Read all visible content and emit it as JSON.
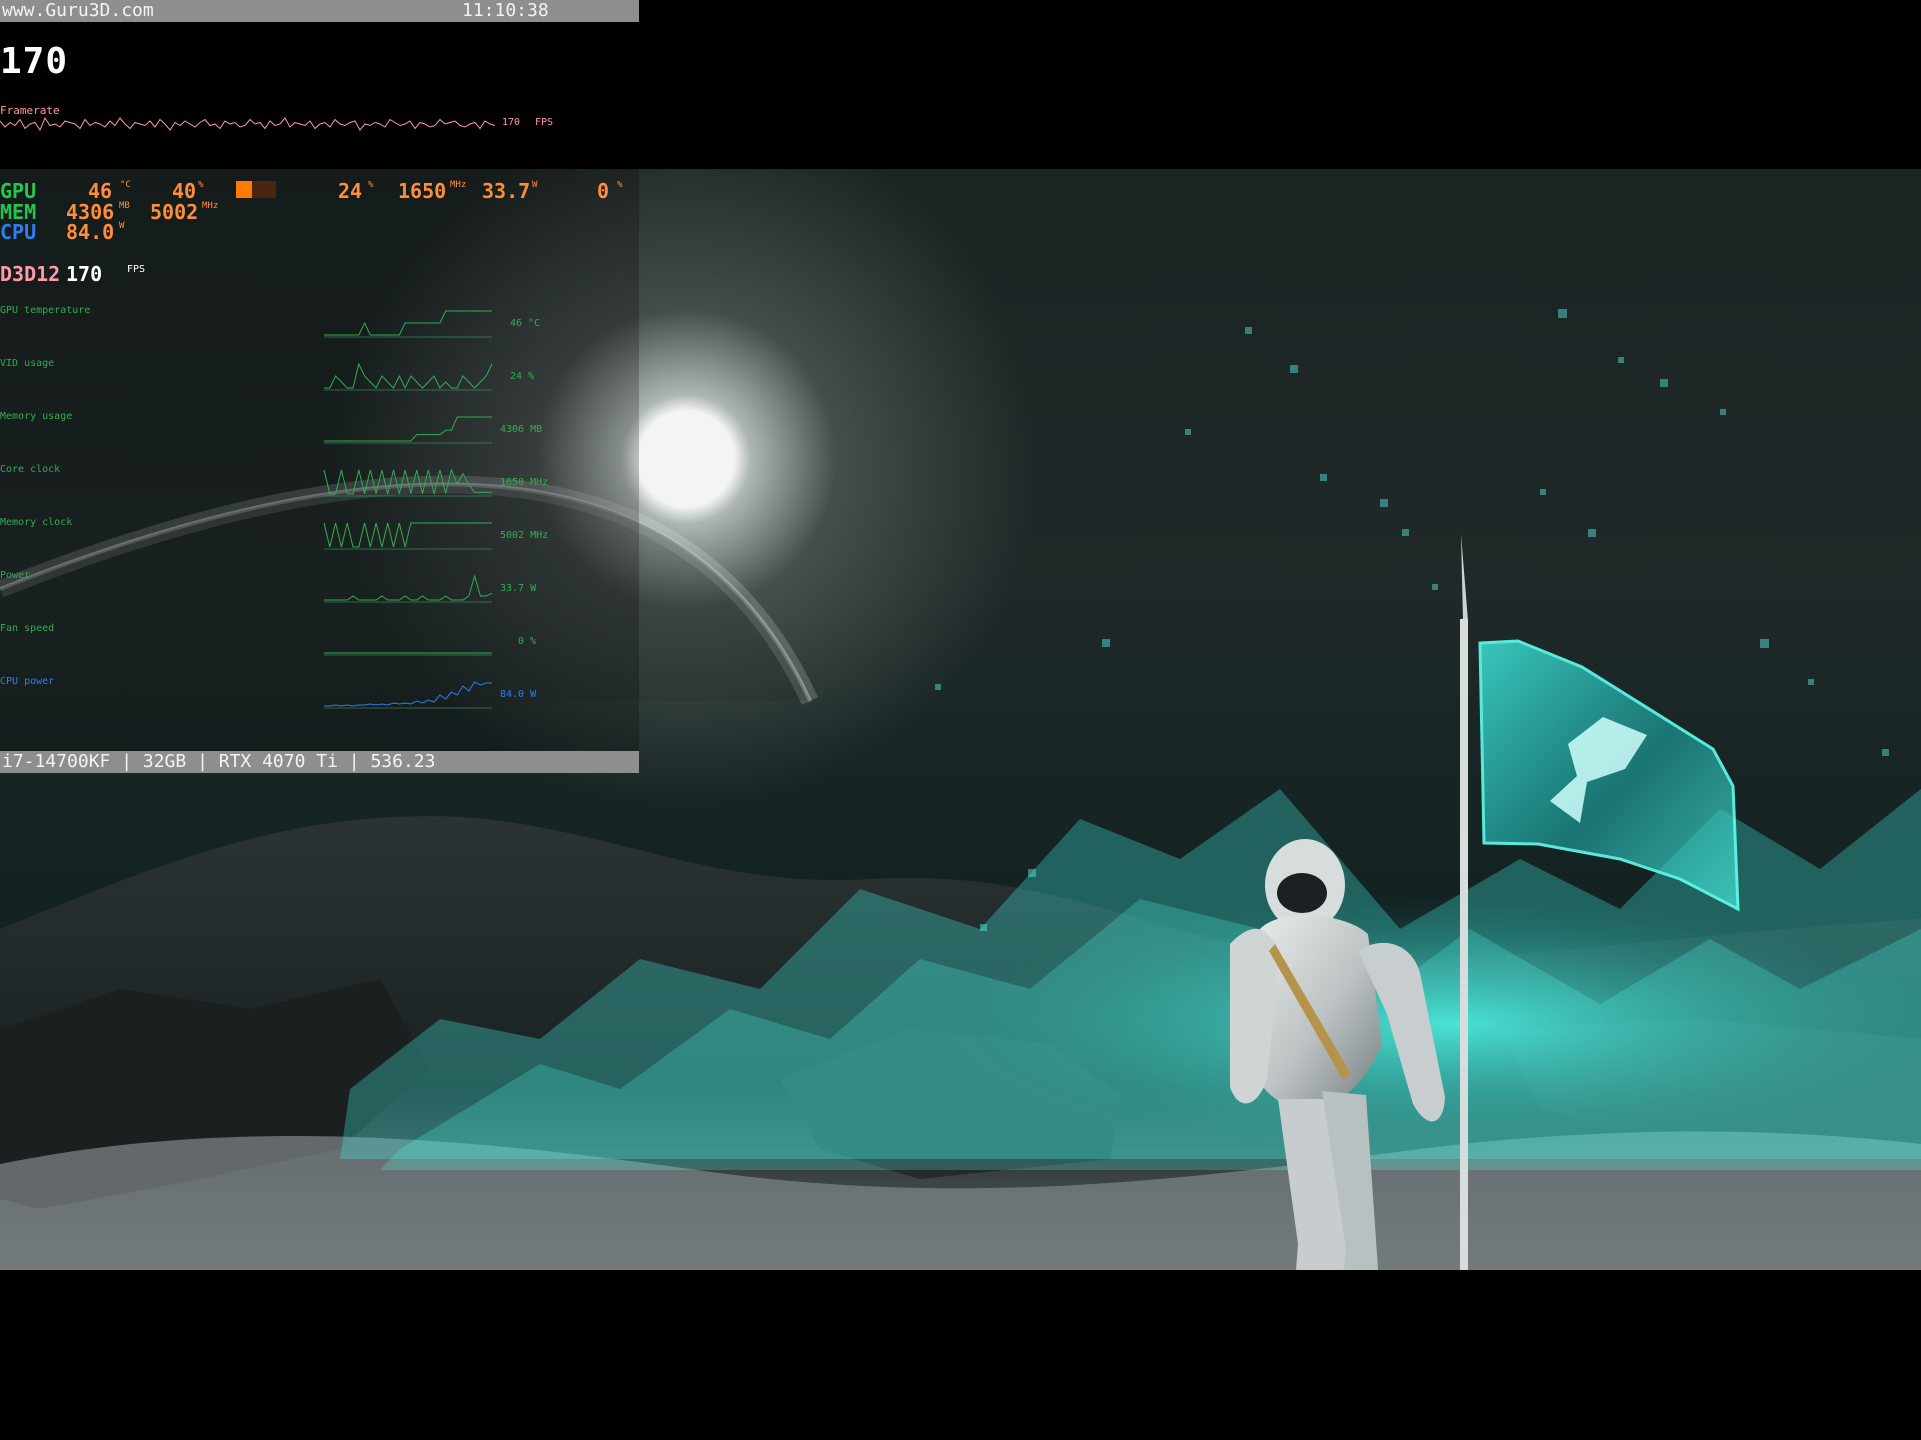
{
  "overlay": {
    "title": {
      "site": "www.Guru3D.com",
      "time": "11:10:38"
    },
    "fps_large": "170",
    "framerate": {
      "label": "Framerate",
      "value": "170",
      "unit": "FPS",
      "samples": [
        172,
        168,
        171,
        169,
        173,
        167,
        170,
        171,
        166,
        174,
        169,
        170,
        168,
        172,
        171,
        170,
        167,
        173,
        169,
        171,
        170,
        168,
        172,
        169,
        174,
        170,
        167,
        171,
        170,
        169,
        172,
        168,
        173,
        170,
        166,
        171,
        169,
        172,
        170,
        168,
        171,
        173,
        169,
        170,
        167,
        172,
        170,
        171,
        168,
        169,
        173,
        170,
        171,
        167,
        172,
        169,
        170,
        174,
        168,
        171,
        170,
        169,
        172,
        167,
        170,
        171,
        168,
        173,
        170,
        169,
        171,
        172,
        166,
        170,
        169,
        171,
        170,
        168,
        173,
        171,
        169,
        170,
        172,
        167,
        171,
        170,
        168,
        169,
        173,
        170,
        171,
        172,
        169,
        168,
        170,
        171,
        167,
        172,
        170,
        169
      ]
    },
    "stats": {
      "gpu": {
        "label": "GPU",
        "temp": "46",
        "temp_unit": "°C",
        "usage": "40",
        "usage_unit": "%",
        "fan_fill": 0.4,
        "vid": "24",
        "vid_unit": "%",
        "core_clock": "1650",
        "core_clock_unit": "MHz",
        "power": "33.7",
        "power_unit": "W",
        "fan": "0",
        "fan_unit": "%"
      },
      "mem": {
        "label": "MEM",
        "usage": "4306",
        "usage_unit": "MB",
        "clock": "5002",
        "clock_unit": "MHz"
      },
      "cpu": {
        "label": "CPU",
        "power": "84.0",
        "power_unit": "W"
      },
      "api": {
        "label": "D3D12",
        "fps": "170",
        "unit": "FPS"
      }
    },
    "metrics": [
      {
        "label": "GPU temperature",
        "value": "46 °C",
        "color": "#2faf4f",
        "samples": [
          44,
          44,
          44,
          44,
          44,
          44,
          44,
          45,
          44,
          44,
          44,
          44,
          44,
          44,
          45,
          45,
          45,
          45,
          45,
          45,
          45,
          46,
          46,
          46,
          46,
          46,
          46,
          46,
          46,
          46
        ]
      },
      {
        "label": "VID usage",
        "value": "24 %",
        "color": "#2faf4f",
        "samples": [
          20,
          20,
          22,
          21,
          20,
          20,
          24,
          22,
          21,
          20,
          22,
          21,
          20,
          22,
          20,
          22,
          21,
          20,
          21,
          22,
          20,
          21,
          20,
          20,
          22,
          21,
          20,
          21,
          22,
          24
        ]
      },
      {
        "label": "Memory usage",
        "value": "4306 MB",
        "color": "#2faf4f",
        "samples": [
          3970,
          3970,
          3970,
          3970,
          3970,
          3970,
          3970,
          3970,
          3970,
          3970,
          3970,
          3970,
          3970,
          3970,
          3970,
          3970,
          4060,
          4060,
          4060,
          4060,
          4060,
          4120,
          4120,
          4306,
          4306,
          4306,
          4306,
          4306,
          4306,
          4306
        ]
      },
      {
        "label": "Core clock",
        "value": "1650 MHz",
        "color": "#2faf4f",
        "samples": [
          2550,
          1580,
          1580,
          2550,
          1590,
          1580,
          2550,
          1590,
          2550,
          1600,
          2550,
          1580,
          2550,
          1590,
          2550,
          1600,
          2550,
          1600,
          2550,
          1580,
          2550,
          1600,
          2550,
          1980,
          2400,
          1960,
          1650,
          1650,
          1650,
          1650
        ]
      },
      {
        "label": "Memory clock",
        "value": "5002 MHz",
        "color": "#2faf4f",
        "samples": [
          10500,
          5002,
          10500,
          5002,
          10500,
          5002,
          5002,
          10500,
          5002,
          10500,
          5002,
          10500,
          5002,
          10500,
          5002,
          10500,
          10500,
          10500,
          10500,
          10500,
          10500,
          10500,
          10500,
          10500,
          10500,
          10500,
          10500,
          10500,
          10500,
          10500
        ]
      },
      {
        "label": "Power",
        "value": "33.7 W",
        "color": "#2faf4f",
        "samples": [
          32,
          32,
          32,
          32,
          32,
          33,
          32,
          32,
          32,
          32,
          33,
          32,
          32,
          32,
          33,
          32,
          32,
          33,
          32,
          32,
          32,
          33,
          32,
          32,
          32,
          33,
          38,
          33,
          33,
          33.7
        ]
      },
      {
        "label": "Fan speed",
        "value": "0 %",
        "color": "#2faf4f",
        "samples": [
          0,
          0,
          0,
          0,
          0,
          0,
          0,
          0,
          0,
          0,
          0,
          0,
          0,
          0,
          0,
          0,
          0,
          0,
          0,
          0,
          0,
          0,
          0,
          0,
          0,
          0,
          0,
          0,
          0,
          0
        ]
      },
      {
        "label": "CPU power",
        "value": "84.0 W",
        "color": "#2b7ff0",
        "samples": [
          61,
          61,
          62,
          61,
          62,
          61,
          62,
          62,
          63,
          62,
          63,
          62,
          64,
          63,
          64,
          63,
          66,
          64,
          67,
          65,
          72,
          68,
          75,
          72,
          81,
          76,
          85,
          82,
          84,
          84
        ]
      }
    ],
    "footer": "i7-14700KF | 32GB | RTX 4070 Ti | 536.23"
  }
}
